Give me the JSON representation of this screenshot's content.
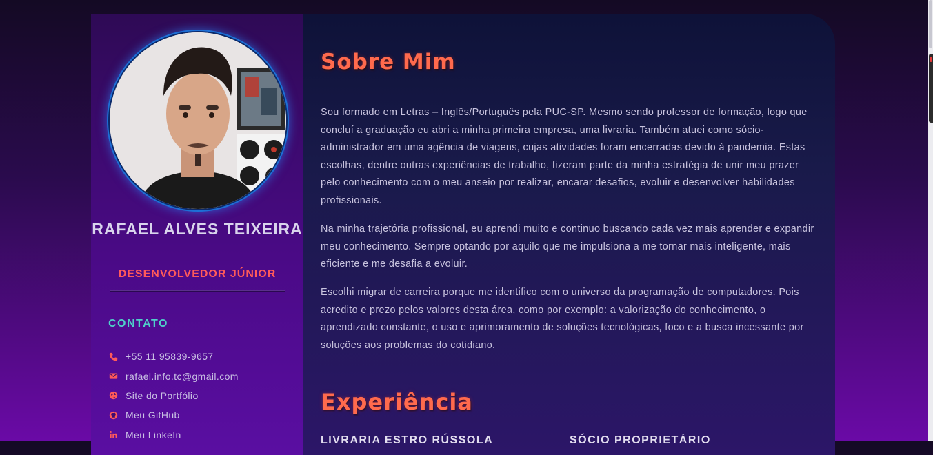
{
  "profile": {
    "name": "RAFAEL ALVES TEIXEIRA",
    "role": "DESENVOLVEDOR JÚNIOR"
  },
  "contact": {
    "title": "CONTATO",
    "items": [
      {
        "icon": "phone-icon",
        "text": "+55 11 95839-9657"
      },
      {
        "icon": "mail-icon",
        "text": "rafael.info.tc@gmail.com"
      },
      {
        "icon": "globe-icon",
        "text": "Site do Portfólio"
      },
      {
        "icon": "github-icon",
        "text": "Meu GitHub"
      },
      {
        "icon": "linkedin-icon",
        "text": "Meu LinkeIn"
      }
    ]
  },
  "about": {
    "title": "Sobre Mim",
    "paragraphs": [
      "Sou formado em Letras – Inglês/Português pela PUC-SP. Mesmo sendo professor de formação, logo que concluí a graduação eu abri a minha primeira empresa, uma livraria. Também atuei como sócio-administrador em uma agência de viagens, cujas atividades foram encerradas devido à pandemia. Estas escolhas, dentre outras experiências de trabalho, fizeram parte da minha estratégia de unir meu prazer pelo conhecimento com o meu anseio por realizar, encarar desafios, evoluir e desenvolver habilidades profissionais.",
      "Na minha trajetória profissional, eu aprendi muito e continuo buscando cada vez mais aprender e expandir meu conhecimento. Sempre optando por aquilo que me impulsiona a me tornar mais inteligente, mais eficiente e me desafia a evoluir.",
      "Escolhi migrar de carreira porque me identifico com o universo da programação de computadores. Pois acredito e prezo pelos valores desta área, como por exemplo: a valorização do conhecimento, o aprendizado constante, o uso e aprimoramento de soluções tecnológicas, foco e a busca incessante por soluções aos problemas do cotidiano."
    ]
  },
  "experience": {
    "title": "Experiência",
    "col1": "LIVRARIA ESTRO RÚSSOLA",
    "col2": "SÓCIO PROPRIETÁRIO"
  },
  "colors": {
    "accent": "#ff6a4d",
    "contact_title": "#4fd0c9",
    "role": "#ff5a5a"
  }
}
